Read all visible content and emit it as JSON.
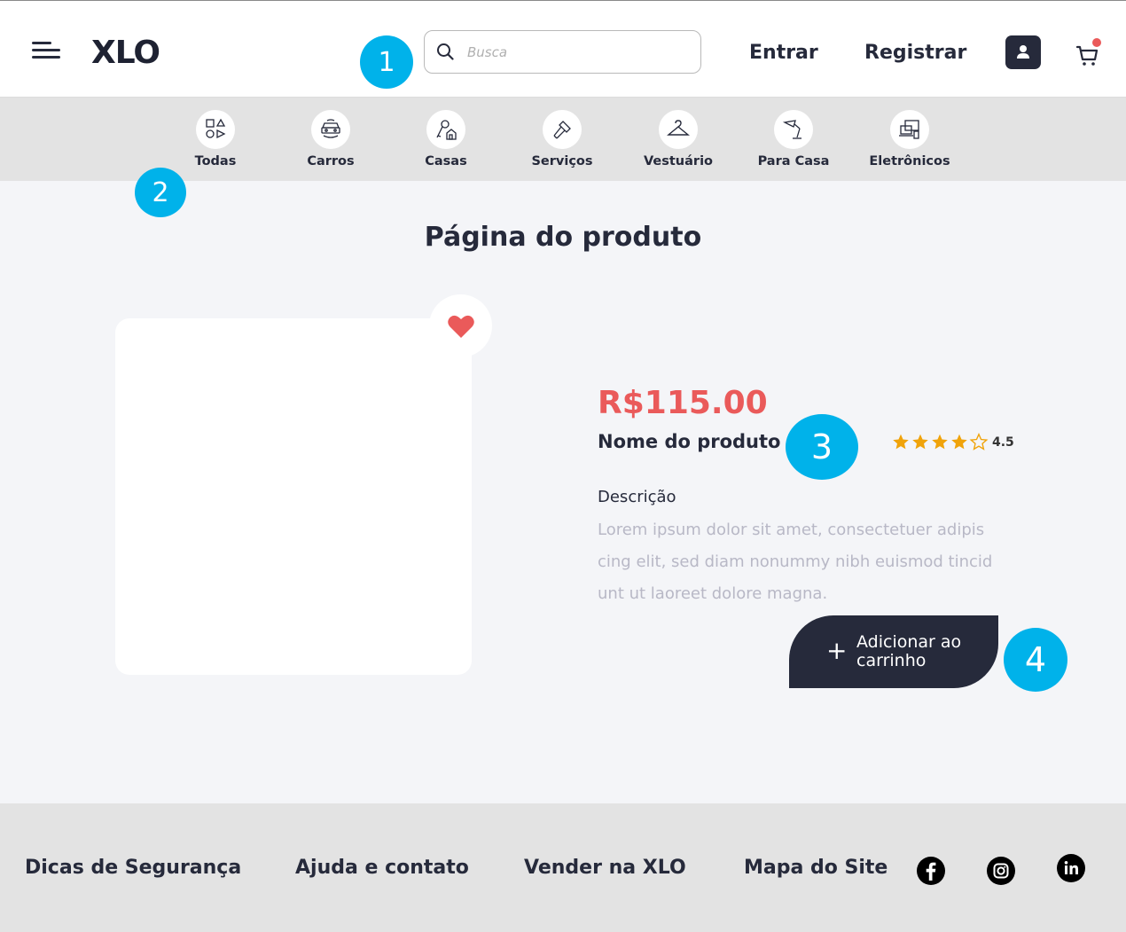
{
  "header": {
    "logo": "XLO",
    "search_placeholder": "Busca",
    "login_label": "Entrar",
    "register_label": "Registrar",
    "icons": [
      "menu-icon",
      "search-icon",
      "user-icon",
      "cart-icon"
    ]
  },
  "categories": [
    {
      "label": "Todas",
      "icon": "shapes-icon"
    },
    {
      "label": "Carros",
      "icon": "car-icon"
    },
    {
      "label": "Casas",
      "icon": "house-key-icon"
    },
    {
      "label": "Serviços",
      "icon": "hammer-icon"
    },
    {
      "label": "Vestuário",
      "icon": "hanger-icon"
    },
    {
      "label": "Para Casa",
      "icon": "lamp-icon"
    },
    {
      "label": "Eletrônicos",
      "icon": "devices-icon"
    }
  ],
  "markers": [
    "1",
    "2",
    "3",
    "4"
  ],
  "main": {
    "title": "Página do produto",
    "price": "R$115.00",
    "product_name": "Nome do produto",
    "rating": {
      "value": "4.5",
      "stars_filled": 4,
      "stars_total": 5
    },
    "description_label": "Descrição",
    "description": "Lorem ipsum dolor sit amet, consectetuer adipis cing elit, sed diam nonummy nibh euismod tincid unt ut laoreet dolore magna.",
    "add_to_cart_label": "Adicionar ao carrinho",
    "accent_color": "#ea5a5a",
    "dark_color": "#262a3b"
  },
  "footer": {
    "links": [
      "Dicas de Segurança",
      "Ajuda e contato",
      "Vender na XLO",
      "Mapa do Site"
    ],
    "social": [
      "facebook-icon",
      "instagram-icon",
      "linkedin-icon"
    ]
  }
}
